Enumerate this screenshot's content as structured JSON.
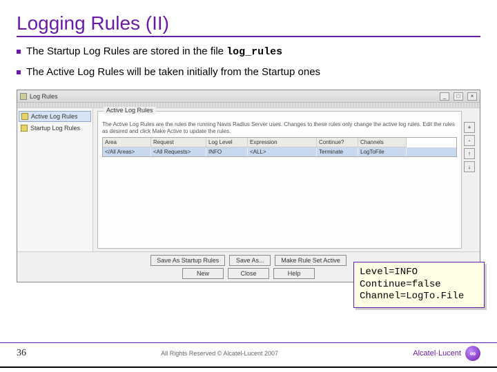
{
  "title": "Logging Rules (II)",
  "bullets": [
    {
      "pre": "The Startup Log Rules are stored in the file ",
      "code": "log_rules"
    },
    {
      "pre": "The Active Log Rules will be taken initially from the Startup ones",
      "code": ""
    }
  ],
  "window": {
    "title": "Log Rules",
    "nav": [
      {
        "label": "Active Log Rules",
        "active": true
      },
      {
        "label": "Startup Log Rules",
        "active": false
      }
    ],
    "group_legend": "Active Log Rules",
    "description": "The Active Log Rules are the rules the running Navis Radius Server uses. Changes to these rules only change the active log rules. Edit the rules as desired and click Make Active to update the rules.",
    "columns": [
      "Area",
      "Request",
      "Log Level",
      "Expression",
      "Continue?",
      "Channels"
    ],
    "rows": [
      {
        "cells": [
          "</All Areas>",
          "<All Requests>",
          "INFO",
          "<ALL>",
          "Terminate",
          "LogToFile"
        ],
        "selected": true
      }
    ],
    "tools": [
      "+",
      "-",
      "↑",
      "↓"
    ],
    "buttons_row1": [
      "Save As Startup Rules",
      "Save As...",
      "Make Rule Set Active"
    ],
    "buttons_row2": [
      "New",
      "Close",
      "Help"
    ]
  },
  "callout": {
    "lines": [
      "Level=INFO",
      "Continue=false",
      "Channel=LogTo.File"
    ]
  },
  "footer": {
    "page": "36",
    "copyright": "All Rights Reserved © Alcatel-Lucent 2007",
    "brand": "Alcatel·Lucent"
  }
}
